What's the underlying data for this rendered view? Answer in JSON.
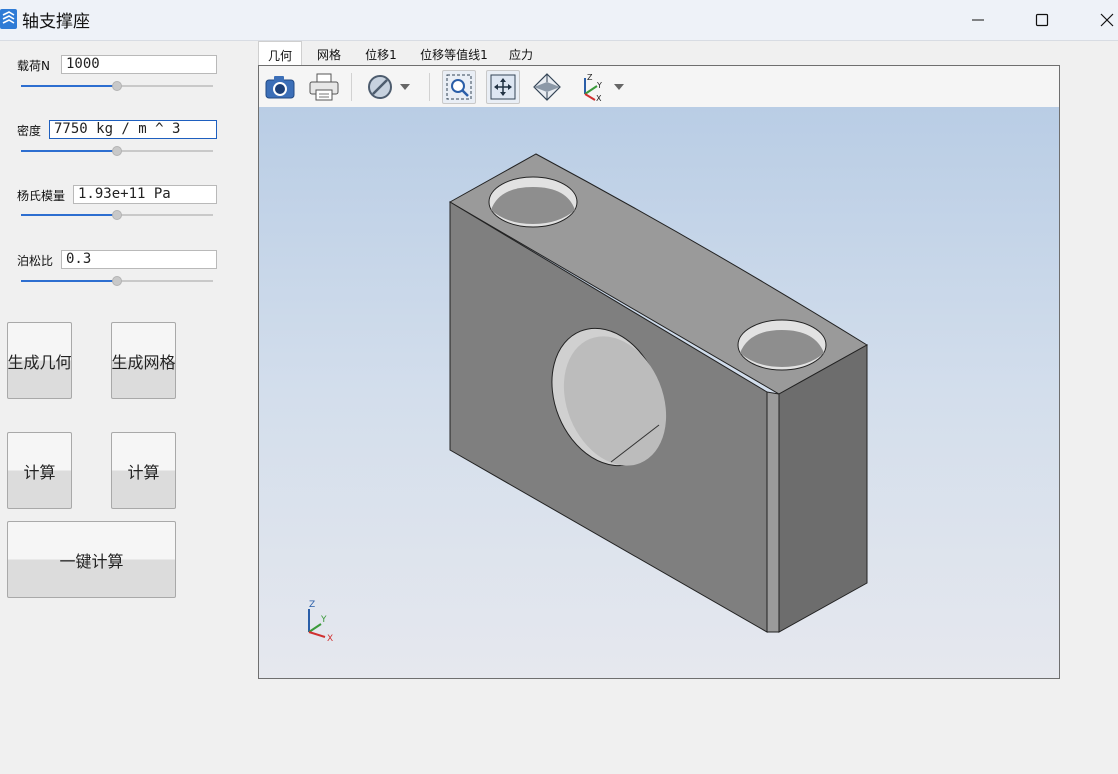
{
  "window": {
    "title": "轴支撑座"
  },
  "params": [
    {
      "label": "载荷N",
      "value": "1000"
    },
    {
      "label": "密度",
      "value": "7750 kg / m ^ 3"
    },
    {
      "label": "杨氏模量",
      "value": "1.93e+11 Pa"
    },
    {
      "label": "泊松比",
      "value": "0.3"
    }
  ],
  "buttons": {
    "gen_geometry": "生成几何",
    "gen_mesh": "生成网格",
    "compute_1": "计算",
    "compute_2": "计算",
    "one_click": "一键计算"
  },
  "tabs": [
    "几何",
    "网格",
    "位移1",
    "位移等值线1",
    "应力"
  ],
  "active_tab": "几何",
  "toolbar_icons": [
    "camera-icon",
    "print-icon",
    "clip-icon",
    "zoom-box-icon",
    "fit-all-icon",
    "view-iso-icon",
    "axes-icon"
  ],
  "axes_labels": {
    "z": "Z",
    "y": "Y",
    "x": "X"
  },
  "colors": {
    "accent": "#2d6ed0",
    "model_face": "#7f7f7f",
    "model_side": "#6d6d6d"
  }
}
